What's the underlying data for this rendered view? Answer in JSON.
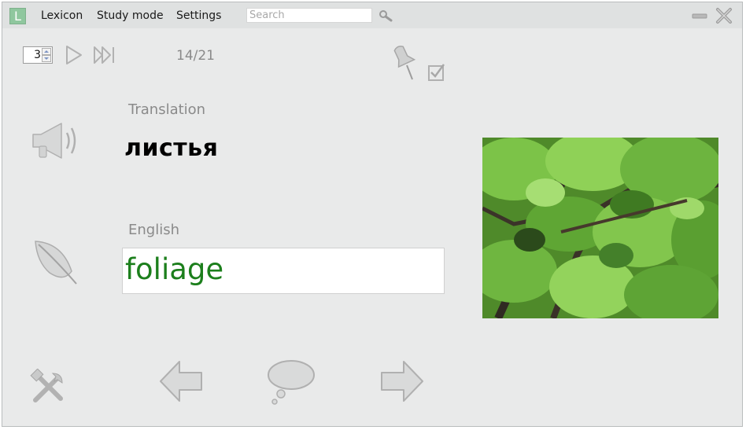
{
  "app": {
    "logo_letter": "L",
    "menu": [
      "Lexicon",
      "Study mode",
      "Settings"
    ],
    "search_placeholder": "Search"
  },
  "toolbar": {
    "repeat_count": "3",
    "progress": "14/21",
    "checkbox_checked": true
  },
  "card": {
    "question_label": "Translation",
    "question_word": "листья",
    "answer_label": "English",
    "answer_value": "foliage",
    "picture_subject": "green leaves"
  },
  "colors": {
    "answer_text": "#1c7f1c",
    "logo_bg": "#8fc79e",
    "window_bg": "#e9eaea"
  },
  "icons": [
    "search-icon",
    "minimize-icon",
    "close-icon",
    "play-icon",
    "skip-forward-icon",
    "pin-icon",
    "checkbox-icon",
    "speaker-icon",
    "feather-icon",
    "tools-icon",
    "back-arrow-icon",
    "speech-bubble-icon",
    "forward-arrow-icon"
  ]
}
